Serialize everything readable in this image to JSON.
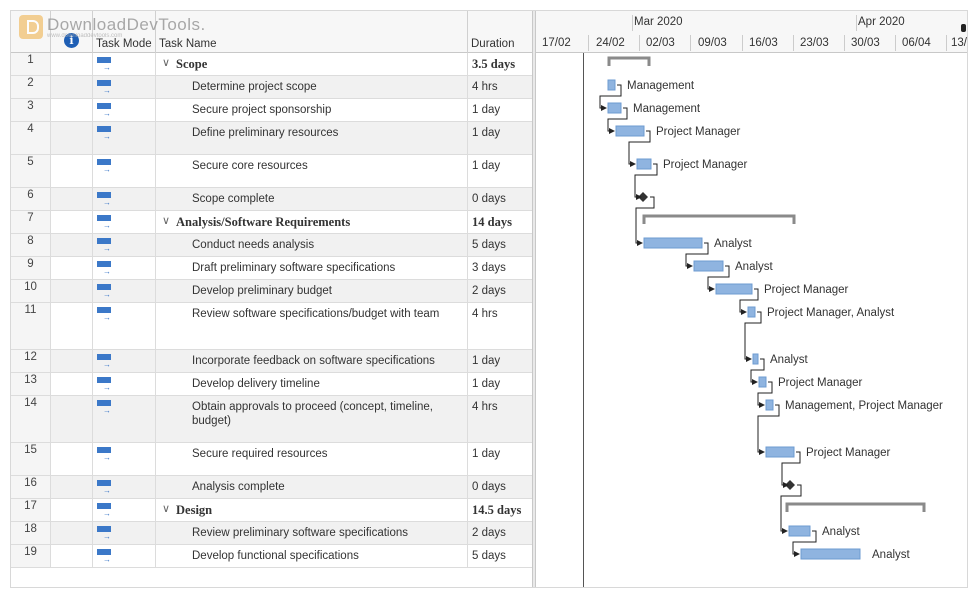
{
  "watermark": {
    "text": "DownloadDevTools.",
    "sub": "www.downloaddevtools.com"
  },
  "columns": {
    "mode": "Task Mode",
    "name": "Task Name",
    "duration": "Duration"
  },
  "timeline": {
    "months": [
      "Mar 2020",
      "Apr 2020"
    ],
    "weeks": [
      "17/02",
      "24/02",
      "02/03",
      "09/03",
      "16/03",
      "23/03",
      "30/03",
      "06/04",
      "13/"
    ]
  },
  "tasks": [
    {
      "id": "1",
      "name": "Scope",
      "duration": "3.5 days",
      "summary": true
    },
    {
      "id": "2",
      "name": "Determine project scope",
      "duration": "4 hrs",
      "resource": "Management"
    },
    {
      "id": "3",
      "name": "Secure project sponsorship",
      "duration": "1 day",
      "resource": "Management"
    },
    {
      "id": "4",
      "name": "Define preliminary resources",
      "duration": "1 day",
      "resource": "Project Manager"
    },
    {
      "id": "5",
      "name": "Secure core resources",
      "duration": "1 day",
      "resource": "Project Manager"
    },
    {
      "id": "6",
      "name": "Scope complete",
      "duration": "0 days"
    },
    {
      "id": "7",
      "name": "Analysis/Software Requirements",
      "duration": "14 days",
      "summary": true
    },
    {
      "id": "8",
      "name": "Conduct needs analysis",
      "duration": "5 days",
      "resource": "Analyst"
    },
    {
      "id": "9",
      "name": "Draft preliminary software specifications",
      "duration": "3 days",
      "resource": "Analyst"
    },
    {
      "id": "10",
      "name": "Develop preliminary budget",
      "duration": "2 days",
      "resource": "Project Manager"
    },
    {
      "id": "11",
      "name": "Review software specifications/budget with team",
      "duration": "4 hrs",
      "resource": "Project Manager, Analyst"
    },
    {
      "id": "12",
      "name": "Incorporate feedback on software specifications",
      "duration": "1 day",
      "resource": "Analyst"
    },
    {
      "id": "13",
      "name": "Develop delivery timeline",
      "duration": "1 day",
      "resource": "Project Manager"
    },
    {
      "id": "14",
      "name": "Obtain approvals to proceed (concept, timeline, budget)",
      "duration": "4 hrs",
      "resource": "Management, Project Manager"
    },
    {
      "id": "15",
      "name": "Secure required resources",
      "duration": "1 day",
      "resource": "Project Manager"
    },
    {
      "id": "16",
      "name": "Analysis complete",
      "duration": "0 days"
    },
    {
      "id": "17",
      "name": "Design",
      "duration": "14.5 days",
      "summary": true
    },
    {
      "id": "18",
      "name": "Review preliminary software specifications",
      "duration": "2 days",
      "resource": "Analyst"
    },
    {
      "id": "19",
      "name": "Develop functional specifications",
      "duration": "5 days",
      "resource": "Analyst"
    }
  ],
  "colors": {
    "bar": "#8fb4e0",
    "bar_border": "#6e9bd1",
    "summary": "#8a8a8a",
    "mode_icon": "#3b78c8",
    "info_icon": "#1f5fb5"
  }
}
